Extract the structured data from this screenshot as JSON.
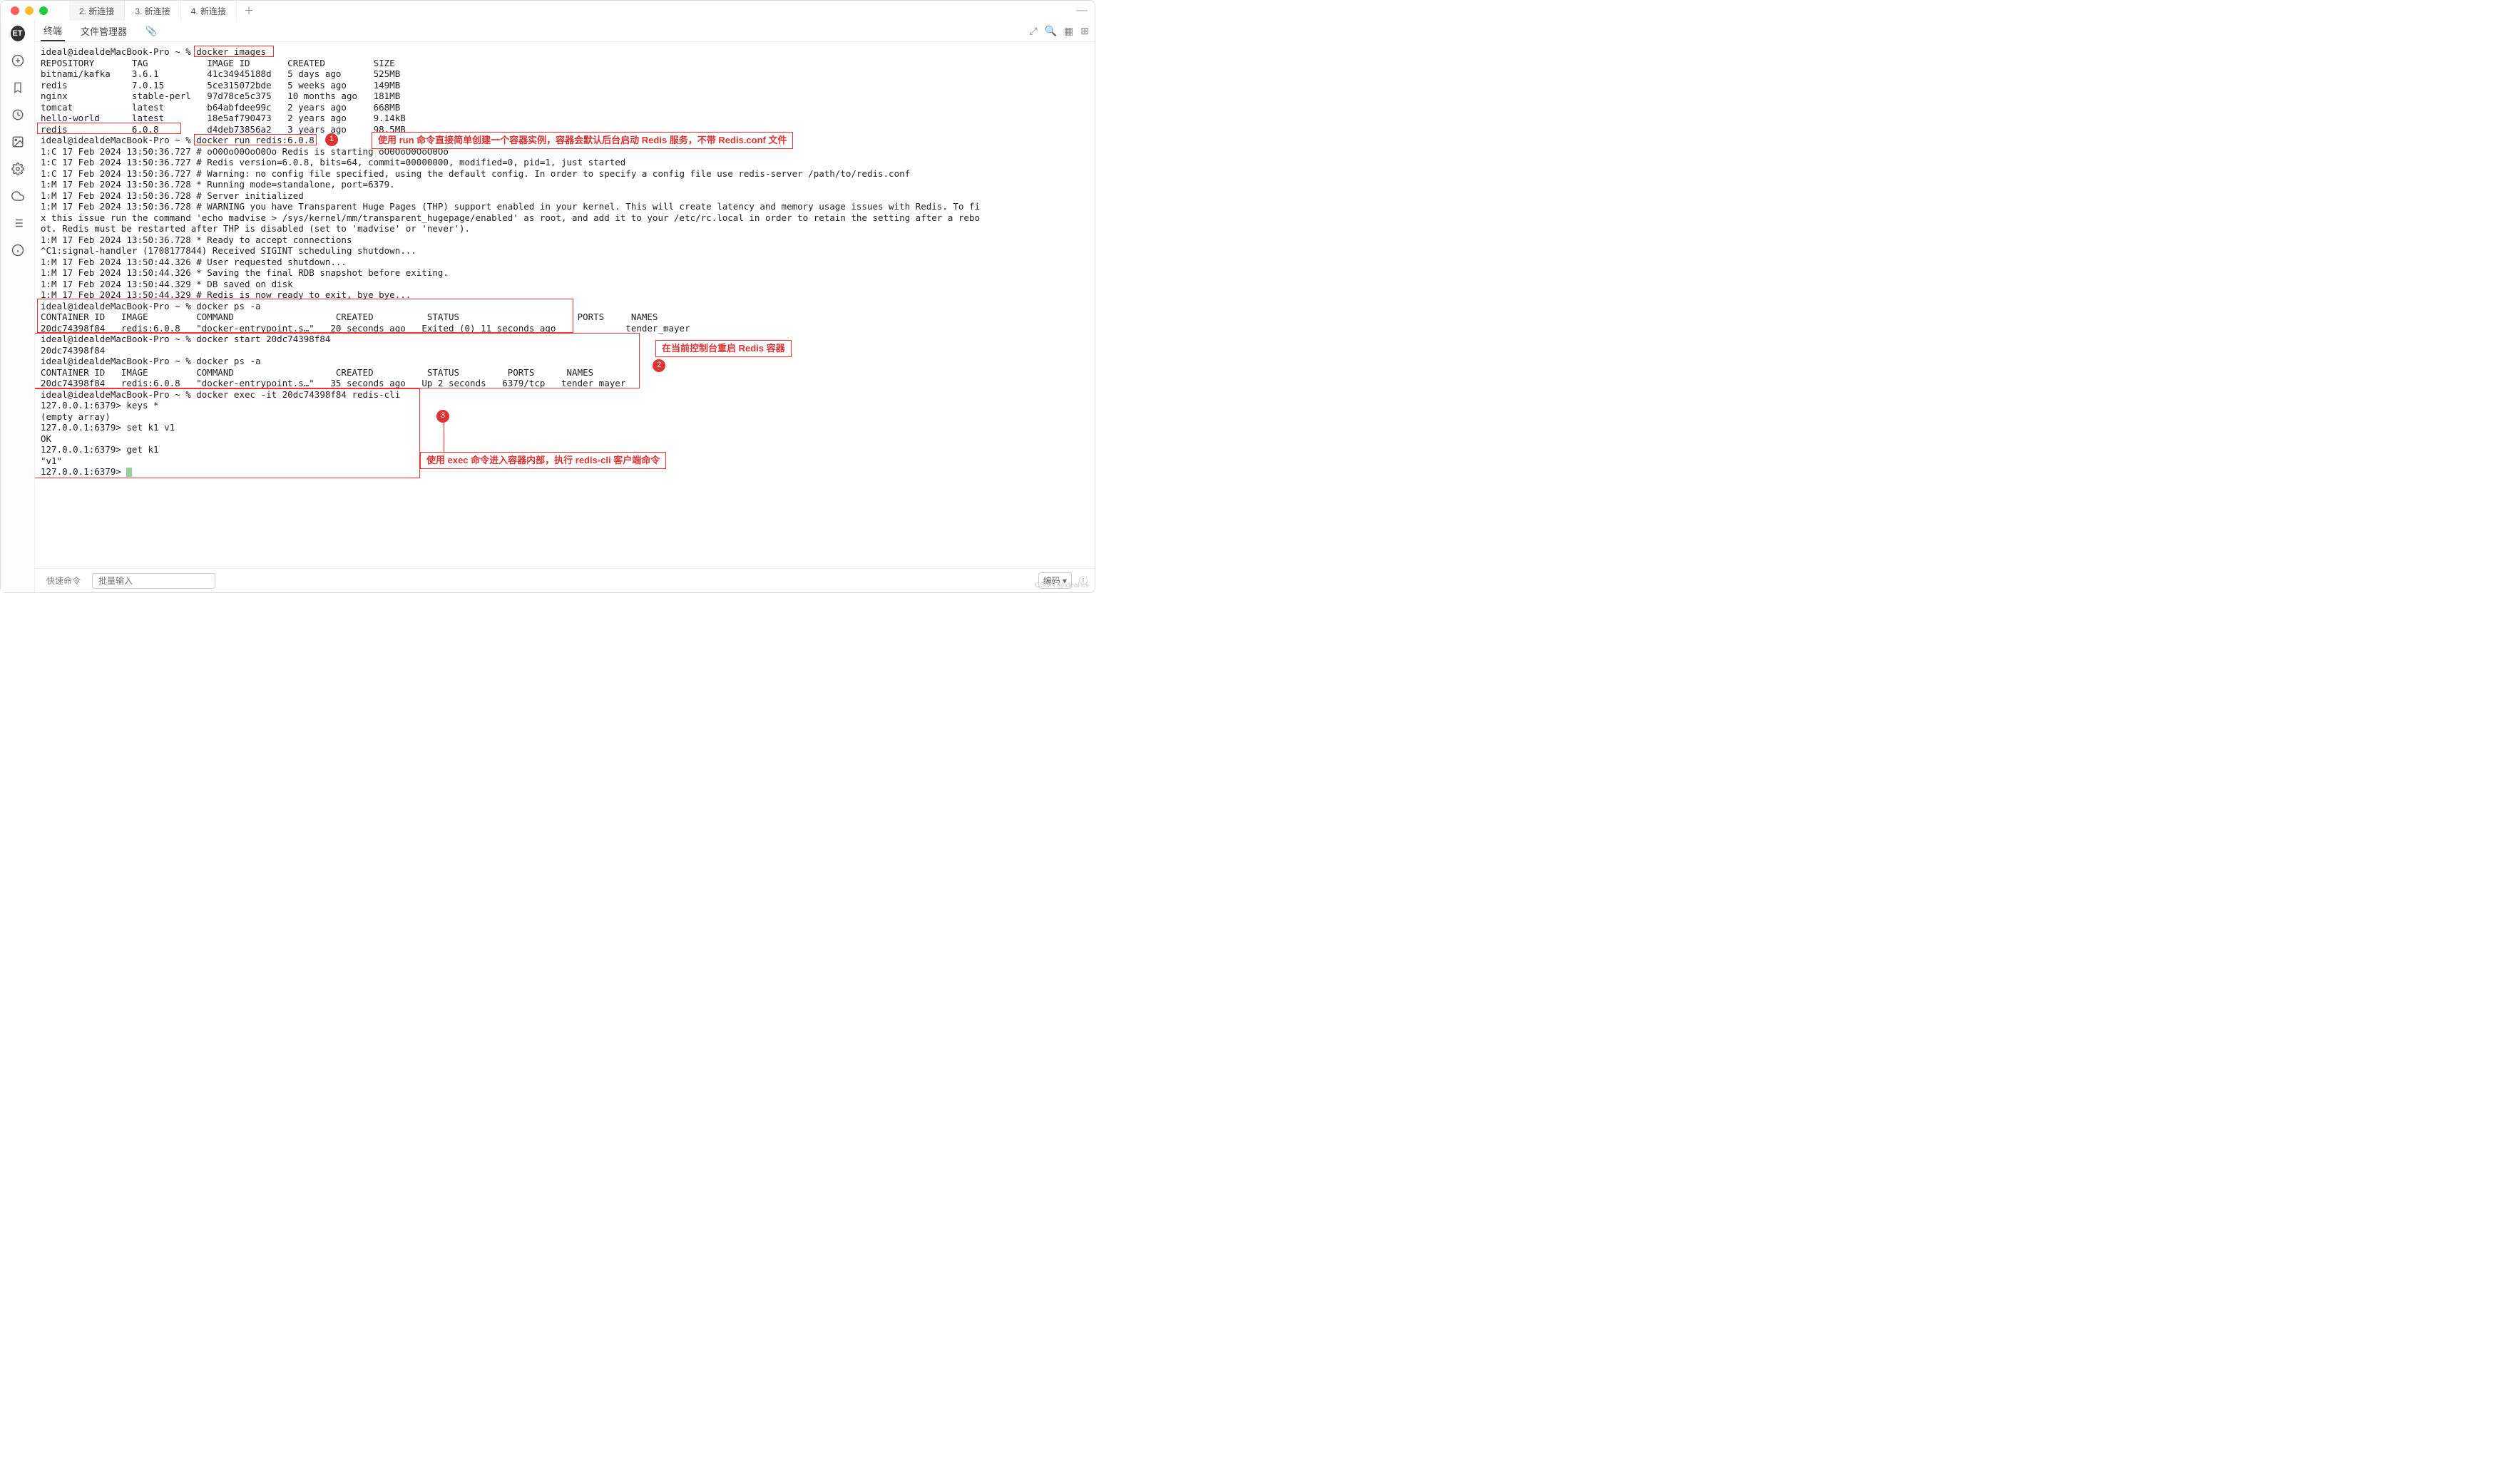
{
  "tabs": [
    {
      "label": "2. 新连接",
      "active": true
    },
    {
      "label": "3. 新连接",
      "active": false
    },
    {
      "label": "4. 新连接",
      "active": false
    }
  ],
  "toolbar": {
    "terminal": "终端",
    "file_manager": "文件管理器"
  },
  "statusbar": {
    "quick": "快速命令",
    "batch_placeholder": "批量输入",
    "encoding": "编码"
  },
  "annotations": {
    "a1": "使用 run 命令直接简单创建一个容器实例，容器会默认后台启动 Redis 服务，不带 Redis.conf 文件",
    "a2": "在当前控制台重启 Redis 容器",
    "a3": "使用 exec 命令进入容器内部，执行 redis-cli 客户端命令",
    "b1": "1",
    "b2": "2",
    "b3": "3"
  },
  "terminal_lines": [
    "ideal@idealdeMacBook-Pro ~ % docker images",
    "REPOSITORY       TAG           IMAGE ID       CREATED         SIZE",
    "bitnami/kafka    3.6.1         41c34945188d   5 days ago      525MB",
    "redis            7.0.15        5ce315072bde   5 weeks ago     149MB",
    "nginx            stable-perl   97d78ce5c375   10 months ago   181MB",
    "tomcat           latest        b64abfdee99c   2 years ago     668MB",
    "hello-world      latest        18e5af790473   2 years ago     9.14kB",
    "redis            6.0.8         d4deb73856a2   3 years ago     98.5MB",
    "ideal@idealdeMacBook-Pro ~ % docker run redis:6.0.8",
    "1:C 17 Feb 2024 13:50:36.727 # oO0OoO0OoO0Oo Redis is starting oO0OoO0OoO0Oo",
    "1:C 17 Feb 2024 13:50:36.727 # Redis version=6.0.8, bits=64, commit=00000000, modified=0, pid=1, just started",
    "1:C 17 Feb 2024 13:50:36.727 # Warning: no config file specified, using the default config. In order to specify a config file use redis-server /path/to/redis.conf",
    "1:M 17 Feb 2024 13:50:36.728 * Running mode=standalone, port=6379.",
    "1:M 17 Feb 2024 13:50:36.728 # Server initialized",
    "1:M 17 Feb 2024 13:50:36.728 # WARNING you have Transparent Huge Pages (THP) support enabled in your kernel. This will create latency and memory usage issues with Redis. To fi",
    "x this issue run the command 'echo madvise > /sys/kernel/mm/transparent_hugepage/enabled' as root, and add it to your /etc/rc.local in order to retain the setting after a rebo",
    "ot. Redis must be restarted after THP is disabled (set to 'madvise' or 'never').",
    "1:M 17 Feb 2024 13:50:36.728 * Ready to accept connections",
    "^C1:signal-handler (1708177844) Received SIGINT scheduling shutdown...",
    "1:M 17 Feb 2024 13:50:44.326 # User requested shutdown...",
    "1:M 17 Feb 2024 13:50:44.326 * Saving the final RDB snapshot before exiting.",
    "1:M 17 Feb 2024 13:50:44.329 * DB saved on disk",
    "1:M 17 Feb 2024 13:50:44.329 # Redis is now ready to exit, bye bye...",
    "ideal@idealdeMacBook-Pro ~ % docker ps -a",
    "CONTAINER ID   IMAGE         COMMAND                   CREATED          STATUS                      PORTS     NAMES",
    "20dc74398f84   redis:6.0.8   \"docker-entrypoint.s…\"   20 seconds ago   Exited (0) 11 seconds ago             tender_mayer",
    "ideal@idealdeMacBook-Pro ~ % docker start 20dc74398f84",
    "20dc74398f84",
    "ideal@idealdeMacBook-Pro ~ % docker ps -a",
    "CONTAINER ID   IMAGE         COMMAND                   CREATED          STATUS         PORTS      NAMES",
    "20dc74398f84   redis:6.0.8   \"docker-entrypoint.s…\"   35 seconds ago   Up 2 seconds   6379/tcp   tender_mayer",
    "ideal@idealdeMacBook-Pro ~ % docker exec -it 20dc74398f84 redis-cli",
    "127.0.0.1:6379> keys *",
    "(empty array)",
    "127.0.0.1:6379> set k1 v1",
    "OK",
    "127.0.0.1:6379> get k1",
    "\"v1\"",
    "127.0.0.1:6379> "
  ],
  "watermark": "CSDN @ideal-cs"
}
